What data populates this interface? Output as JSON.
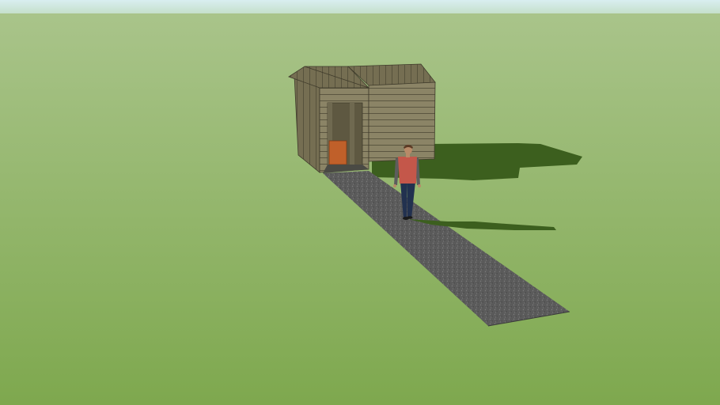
{
  "scene": {
    "colors": {
      "sky_top": "#d9eef0",
      "sky_bottom": "#c4dfc9",
      "ground_far": "#a9c48a",
      "ground_near": "#7ea84e",
      "shadow": "#3c5f1e",
      "path": "#5b5b5b",
      "path_edge": "#3a3a3a",
      "wood_light": "#8b8466",
      "wood_mid": "#756e52",
      "wood_dark": "#5f5942",
      "roof": "#7a7560",
      "door_orange": "#c0602a",
      "shirt": "#c4574a",
      "jeans": "#22314f",
      "skin": "#b88a68",
      "hair": "#5a3a24"
    },
    "objects": {
      "shed": "wooden-shed",
      "path": "gravel-path",
      "person": "walking-person",
      "shed_shadow": "shed-shadow",
      "person_shadow": "person-shadow"
    }
  }
}
